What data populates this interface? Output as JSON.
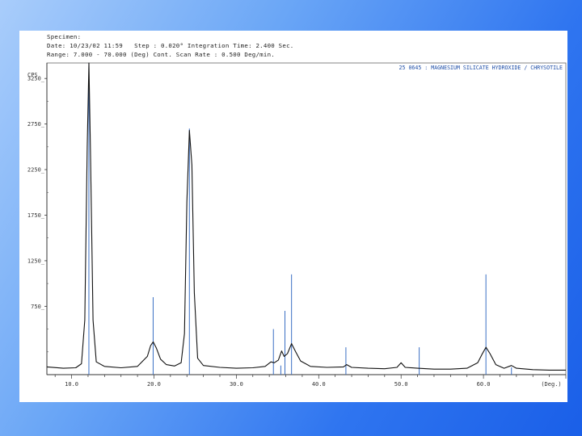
{
  "header": {
    "specimen_line": "Specimen:",
    "date_line": "Date: 10/23/02 11:59   Step : 0.020° Integration Time: 2.400 Sec.",
    "range_line": "Range: 7.000 - 70.000 (Deg) Cont. Scan Rate : 0.500 Deg/min."
  },
  "chart_data": {
    "type": "line",
    "title": "",
    "xlabel": "(Deg.)",
    "ylabel": "CPS",
    "xlim": [
      7,
      70
    ],
    "ylim": [
      0,
      3420
    ],
    "xticks": [
      10,
      20,
      30,
      40,
      50,
      60
    ],
    "xtick_labels": [
      "10.0",
      "20.0",
      "30.0",
      "40.0",
      "50.0",
      "60.0"
    ],
    "yticks": [
      750,
      1250,
      1750,
      2250,
      2750,
      3250
    ],
    "ytick_labels": [
      "750_",
      "1250_",
      "1750_",
      "2250_",
      "2750_",
      "3250_"
    ],
    "reference_pattern": {
      "label": "25 0645 : MAGNESIUM SILICATE HYDROXIDE / CHRYSOTILE",
      "color": "#3a6fc4",
      "lines": [
        {
          "x": 12.1,
          "y": 3420
        },
        {
          "x": 19.9,
          "y": 850
        },
        {
          "x": 24.3,
          "y": 2700
        },
        {
          "x": 34.5,
          "y": 500
        },
        {
          "x": 35.4,
          "y": 100
        },
        {
          "x": 35.9,
          "y": 700
        },
        {
          "x": 36.7,
          "y": 1100
        },
        {
          "x": 43.3,
          "y": 300
        },
        {
          "x": 52.2,
          "y": 300
        },
        {
          "x": 60.3,
          "y": 1100
        },
        {
          "x": 63.4,
          "y": 80
        }
      ]
    },
    "series": [
      {
        "color": "#111111",
        "points": [
          [
            7.0,
            85
          ],
          [
            9.0,
            70
          ],
          [
            10.5,
            75
          ],
          [
            11.2,
            120
          ],
          [
            11.6,
            600
          ],
          [
            11.9,
            2500
          ],
          [
            12.1,
            3420
          ],
          [
            12.3,
            2400
          ],
          [
            12.6,
            600
          ],
          [
            13.0,
            140
          ],
          [
            14.0,
            90
          ],
          [
            16.0,
            75
          ],
          [
            18.0,
            90
          ],
          [
            19.2,
            200
          ],
          [
            19.6,
            320
          ],
          [
            19.9,
            360
          ],
          [
            20.3,
            290
          ],
          [
            20.8,
            170
          ],
          [
            21.5,
            110
          ],
          [
            22.5,
            95
          ],
          [
            23.3,
            130
          ],
          [
            23.7,
            450
          ],
          [
            24.0,
            1900
          ],
          [
            24.3,
            2680
          ],
          [
            24.6,
            2300
          ],
          [
            24.9,
            900
          ],
          [
            25.3,
            180
          ],
          [
            26.0,
            100
          ],
          [
            28.0,
            80
          ],
          [
            30.0,
            70
          ],
          [
            32.0,
            75
          ],
          [
            33.5,
            90
          ],
          [
            34.2,
            140
          ],
          [
            34.6,
            130
          ],
          [
            35.1,
            160
          ],
          [
            35.5,
            260
          ],
          [
            35.8,
            200
          ],
          [
            36.2,
            230
          ],
          [
            36.7,
            340
          ],
          [
            37.2,
            250
          ],
          [
            37.8,
            150
          ],
          [
            39.0,
            90
          ],
          [
            41.0,
            80
          ],
          [
            43.0,
            85
          ],
          [
            43.4,
            110
          ],
          [
            44.0,
            80
          ],
          [
            46.0,
            70
          ],
          [
            48.0,
            65
          ],
          [
            49.5,
            80
          ],
          [
            50.0,
            130
          ],
          [
            50.5,
            80
          ],
          [
            52.0,
            70
          ],
          [
            54.0,
            60
          ],
          [
            56.0,
            60
          ],
          [
            58.0,
            70
          ],
          [
            59.3,
            130
          ],
          [
            59.8,
            220
          ],
          [
            60.3,
            300
          ],
          [
            60.8,
            230
          ],
          [
            61.5,
            110
          ],
          [
            62.5,
            70
          ],
          [
            63.4,
            100
          ],
          [
            64.0,
            70
          ],
          [
            66.0,
            55
          ],
          [
            68.0,
            50
          ],
          [
            70.0,
            50
          ]
        ]
      }
    ]
  }
}
